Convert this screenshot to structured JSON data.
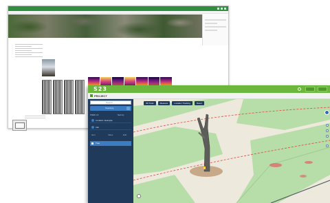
{
  "back_window": {
    "title": "",
    "panel_title": "",
    "thumb_label": ""
  },
  "front_window": {
    "brand": "S23",
    "project": "PROJECT",
    "subbar_right": "",
    "sidebar": {
      "search_placeholder": "Search",
      "tab_label": "Inventory",
      "list_left": "ITEM 1-6",
      "list_right": "Sort by",
      "items": [
        "Location: Example",
        "Info"
      ],
      "row3": [
        "Item",
        "Value",
        "Edit"
      ],
      "selected": "Tree"
    },
    "toolbar": [
      "3D Tools",
      "Measure",
      "Location Tracking",
      "Reset"
    ]
  },
  "colors": {
    "brand_green": "#6bb63c",
    "sidebar_navy": "#1f3a5b",
    "accent_blue": "#3d7cc0",
    "map_lawn": "#b7dda9",
    "map_path": "#f1eee6",
    "dashed_line": "#e2463c"
  }
}
